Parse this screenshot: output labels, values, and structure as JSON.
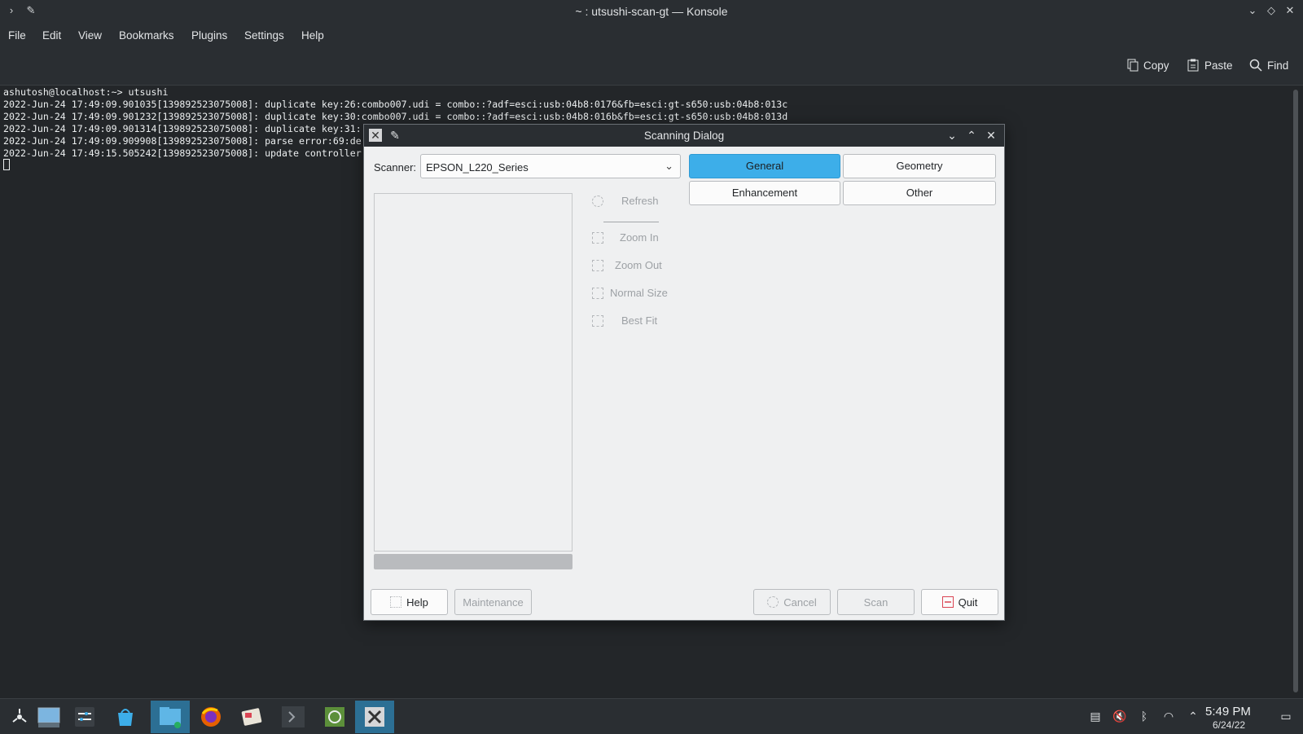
{
  "window": {
    "title": "~ : utsushi-scan-gt — Konsole",
    "controls": [
      "minimize",
      "maximize",
      "close"
    ]
  },
  "menubar": [
    "File",
    "Edit",
    "View",
    "Bookmarks",
    "Plugins",
    "Settings",
    "Help"
  ],
  "toolbar": {
    "copy_label": "Copy",
    "paste_label": "Paste",
    "find_label": "Find"
  },
  "terminal": {
    "lines": [
      "ashutosh@localhost:~> utsushi",
      "2022-Jun-24 17:49:09.901035[139892523075008]: duplicate key:26:combo007.udi = combo::?adf=esci:usb:04b8:0176&fb=esci:gt-s650:usb:04b8:013c",
      "2022-Jun-24 17:49:09.901232[139892523075008]: duplicate key:30:combo007.udi = combo::?adf=esci:usb:04b8:016b&fb=esci:gt-s650:usb:04b8:013d",
      "2022-Jun-24 17:49:09.901314[139892523075008]: duplicate key:31:",
      "2022-Jun-24 17:49:09.909908[139892523075008]: parse error:69:de",
      "2022-Jun-24 17:49:15.505242[139892523075008]: update controller"
    ]
  },
  "dialog": {
    "title": "Scanning Dialog",
    "scanner_label": "Scanner:",
    "scanner_value": "EPSON_L220_Series",
    "side": {
      "refresh": "Refresh",
      "zoom_in": "Zoom In",
      "zoom_out": "Zoom Out",
      "normal_size": "Normal Size",
      "best_fit": "Best Fit"
    },
    "tabs": {
      "general": "General",
      "geometry": "Geometry",
      "enhancement": "Enhancement",
      "other": "Other"
    },
    "buttons": {
      "help": "Help",
      "maintenance": "Maintenance",
      "cancel": "Cancel",
      "scan": "Scan",
      "quit": "Quit"
    }
  },
  "taskbar": {
    "time": "5:49 PM",
    "date": "6/24/22"
  },
  "colors": {
    "accent": "#3daee9",
    "window_bg": "#232629",
    "dialog_bg": "#eff0f1",
    "quit_icon": "#da4453"
  }
}
